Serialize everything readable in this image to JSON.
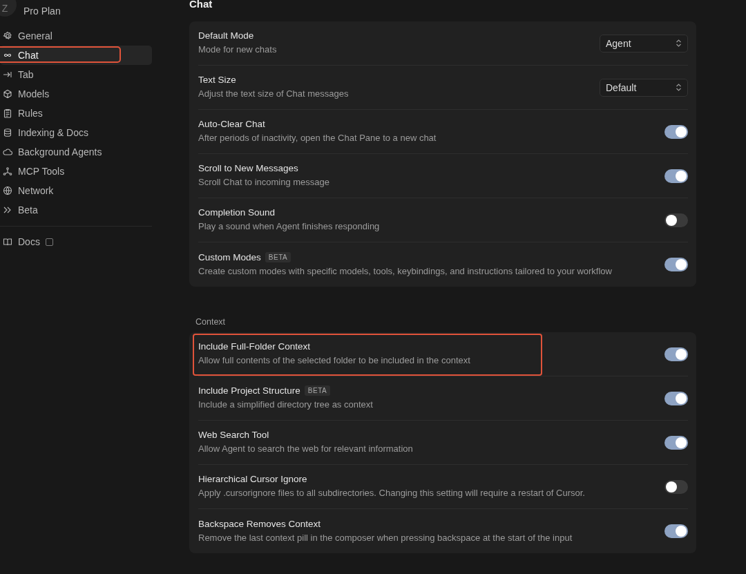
{
  "account": {
    "avatar_letter": "Z",
    "plan": "Pro Plan"
  },
  "sidebar": {
    "items": [
      {
        "label": "General",
        "selected": false,
        "highlighted": false
      },
      {
        "label": "Chat",
        "selected": true,
        "highlighted": true
      },
      {
        "label": "Tab",
        "selected": false,
        "highlighted": false
      },
      {
        "label": "Models",
        "selected": false,
        "highlighted": false
      },
      {
        "label": "Rules",
        "selected": false,
        "highlighted": false
      },
      {
        "label": "Indexing & Docs",
        "selected": false,
        "highlighted": false
      },
      {
        "label": "Background Agents",
        "selected": false,
        "highlighted": false
      },
      {
        "label": "MCP Tools",
        "selected": false,
        "highlighted": false
      },
      {
        "label": "Network",
        "selected": false,
        "highlighted": false
      },
      {
        "label": "Beta",
        "selected": false,
        "highlighted": false
      }
    ],
    "footer_items": [
      {
        "label": "Docs",
        "selected": false
      }
    ]
  },
  "page_title": "Chat",
  "sections": [
    {
      "rows": [
        {
          "kind": "select",
          "title": "Default Mode",
          "description": "Mode for new chats",
          "value": "Agent",
          "highlighted": false
        },
        {
          "kind": "select",
          "title": "Text Size",
          "description": "Adjust the text size of Chat messages",
          "value": "Default",
          "highlighted": false
        },
        {
          "kind": "toggle",
          "title": "Auto-Clear Chat",
          "description": "After periods of inactivity, open the Chat Pane to a new chat",
          "on": true,
          "highlighted": false
        },
        {
          "kind": "toggle",
          "title": "Scroll to New Messages",
          "description": "Scroll Chat to incoming message",
          "on": true,
          "highlighted": false
        },
        {
          "kind": "toggle",
          "title": "Completion Sound",
          "description": "Play a sound when Agent finishes responding",
          "on": false,
          "highlighted": false
        },
        {
          "kind": "toggle",
          "title": "Custom Modes",
          "badge": "BETA",
          "description": "Create custom modes with specific models, tools, keybindings, and instructions tailored to your workflow",
          "on": true,
          "highlighted": false
        }
      ]
    },
    {
      "heading": "Context",
      "rows": [
        {
          "kind": "toggle",
          "title": "Include Full-Folder Context",
          "description": "Allow full contents of the selected folder to be included in the context",
          "on": true,
          "highlighted": true
        },
        {
          "kind": "toggle",
          "title": "Include Project Structure",
          "badge": "BETA",
          "description": "Include a simplified directory tree as context",
          "on": true,
          "highlighted": false
        },
        {
          "kind": "toggle",
          "title": "Web Search Tool",
          "description": "Allow Agent to search the web for relevant information",
          "on": true,
          "highlighted": false
        },
        {
          "kind": "toggle",
          "title": "Hierarchical Cursor Ignore",
          "description": "Apply .cursorignore files to all subdirectories. Changing this setting will require a restart of Cursor.",
          "on": false,
          "highlighted": false
        },
        {
          "kind": "toggle",
          "title": "Backspace Removes Context",
          "description": "Remove the last context pill in the composer when pressing backspace at the start of the input",
          "on": true,
          "highlighted": false
        }
      ]
    }
  ]
}
